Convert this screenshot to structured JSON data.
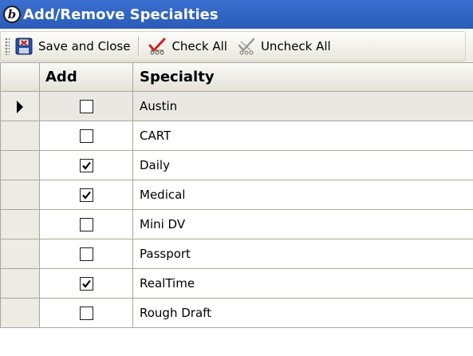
{
  "window": {
    "title": "Add/Remove Specialties",
    "icon_name": "app-logo-icon",
    "icon_glyph": "b",
    "title_bar_color": "#2f63c2"
  },
  "toolbar": {
    "save_label": "Save and Close",
    "check_all_label": "Check All",
    "uncheck_all_label": "Uncheck All",
    "save_icon": "floppy-save-icon",
    "check_all_icon": "check-all-icon",
    "uncheck_all_icon": "uncheck-all-icon"
  },
  "grid": {
    "columns": [
      "Add",
      "Specialty"
    ],
    "current_row_index": 0,
    "rows": [
      {
        "name": "Austin",
        "checked": false
      },
      {
        "name": "CART",
        "checked": false
      },
      {
        "name": "Daily",
        "checked": true
      },
      {
        "name": "Medical",
        "checked": true
      },
      {
        "name": "Mini DV",
        "checked": false
      },
      {
        "name": "Passport",
        "checked": false
      },
      {
        "name": "RealTime",
        "checked": true
      },
      {
        "name": "Rough Draft",
        "checked": false
      }
    ]
  }
}
